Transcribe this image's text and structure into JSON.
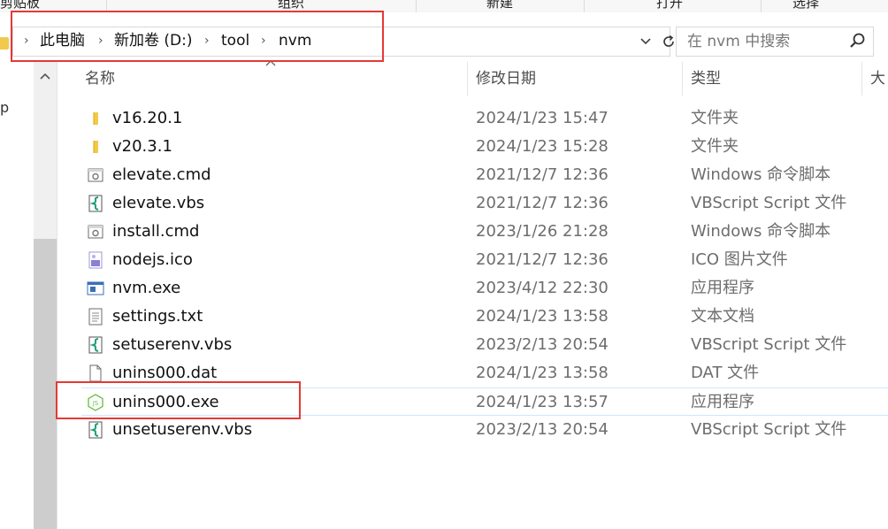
{
  "ribbon": {
    "groups": [
      "剪贴板",
      "组织",
      "新建",
      "打开",
      "选择"
    ]
  },
  "address_bar": {
    "breadcrumbs": [
      "此电脑",
      "新加卷 (D:)",
      "tool",
      "nvm"
    ],
    "dropdown_icon": "chevron-down-icon",
    "refresh_icon": "refresh-icon"
  },
  "search": {
    "placeholder": "在 nvm 中搜索",
    "icon": "search-icon"
  },
  "nav_pane": {
    "partial_text": "p"
  },
  "columns": {
    "name": "名称",
    "date": "修改日期",
    "type": "类型",
    "size": "大"
  },
  "files": [
    {
      "name": "v16.20.1",
      "date": "2024/1/23 15:47",
      "type": "文件夹",
      "icon": "folder-icon"
    },
    {
      "name": "v20.3.1",
      "date": "2024/1/23 15:28",
      "type": "文件夹",
      "icon": "folder-icon"
    },
    {
      "name": "elevate.cmd",
      "date": "2021/12/7 12:36",
      "type": "Windows 命令脚本",
      "icon": "cmd-script-icon"
    },
    {
      "name": "elevate.vbs",
      "date": "2021/12/7 12:36",
      "type": "VBScript Script 文件",
      "icon": "vbs-script-icon"
    },
    {
      "name": "install.cmd",
      "date": "2023/1/26 21:28",
      "type": "Windows 命令脚本",
      "icon": "cmd-script-icon"
    },
    {
      "name": "nodejs.ico",
      "date": "2021/12/7 12:36",
      "type": "ICO 图片文件",
      "icon": "ico-image-icon"
    },
    {
      "name": "nvm.exe",
      "date": "2023/4/12 22:30",
      "type": "应用程序",
      "icon": "exe-app-icon"
    },
    {
      "name": "settings.txt",
      "date": "2024/1/23 13:58",
      "type": "文本文档",
      "icon": "text-document-icon"
    },
    {
      "name": "setuserenv.vbs",
      "date": "2023/2/13 20:54",
      "type": "VBScript Script 文件",
      "icon": "vbs-script-icon"
    },
    {
      "name": "unins000.dat",
      "date": "2024/1/23 13:58",
      "type": "DAT 文件",
      "icon": "blank-file-icon"
    },
    {
      "name": "unins000.exe",
      "date": "2024/1/23 13:57",
      "type": "应用程序",
      "icon": "nodejs-app-icon",
      "selected": true
    },
    {
      "name": "unsetuserenv.vbs",
      "date": "2023/2/13 20:54",
      "type": "VBScript Script 文件",
      "icon": "vbs-script-icon"
    }
  ],
  "colors": {
    "highlight_box": "#e53935",
    "folder": "#f2c94c",
    "selection_border": "#cce8ff"
  }
}
